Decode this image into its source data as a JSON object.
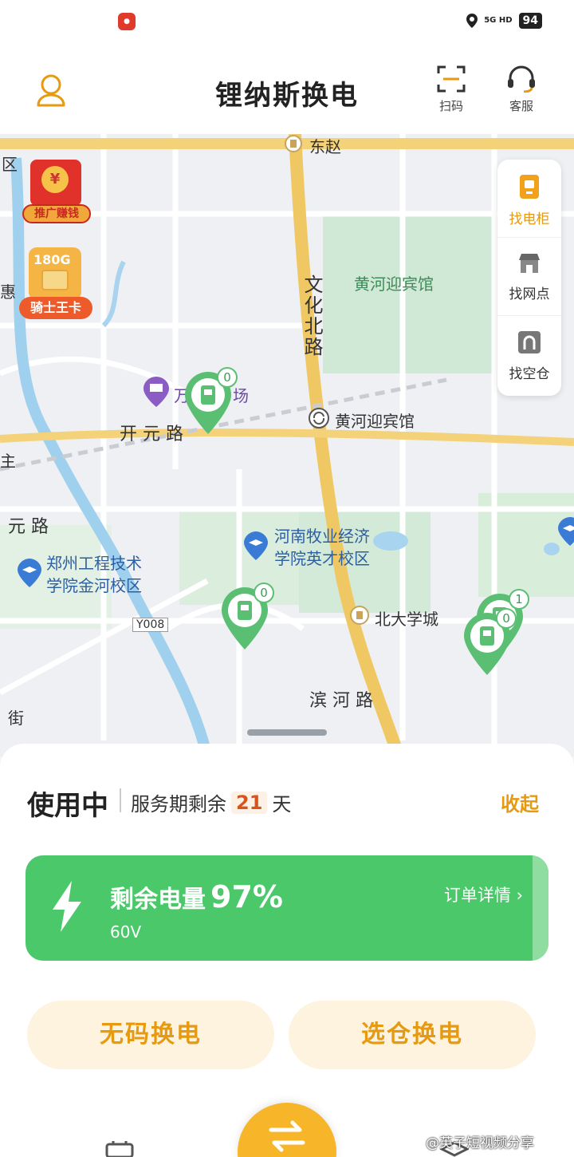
{
  "status_bar": {
    "network": "5G HD",
    "battery": "94"
  },
  "header": {
    "title": "锂纳斯换电",
    "scan_label": "扫码",
    "service_label": "客服"
  },
  "promos": {
    "earn_label": "推广赚钱",
    "sim_data": "180G",
    "sim_label": "骑士王卡"
  },
  "quick_panel": {
    "find_cabinet": "找电柜",
    "find_outlet": "找网点",
    "find_empty": "找空仓"
  },
  "map": {
    "labels": {
      "dongzhao": "东赵",
      "qu": "区",
      "hui": "惠",
      "wenhua_road": "文化北路",
      "yellow_river_hotel_area": "黄河迎宾馆",
      "wan_plaza": "万",
      "chang": "场",
      "kaiyuan_road": "开 元 路",
      "yellow_river_hotel_poi": "黄河迎宾馆",
      "zhu": "主",
      "kaiyuan_road_2": "元 路",
      "henan_college": "河南牧业经济\n学院英才校区",
      "zhengzhou_college": "郑州工程技术\n学院金河校区",
      "y008": "Y008",
      "beida_city": "北大学城",
      "binhe_road": "滨 河 路",
      "jie": "街"
    },
    "markers": [
      {
        "count": "0"
      },
      {
        "count": "0"
      },
      {
        "count": "1"
      },
      {
        "count": "0"
      }
    ]
  },
  "sheet": {
    "status": "使用中",
    "service_prefix": "服务期剩余",
    "days": "21",
    "days_unit": "天",
    "collapse": "收起",
    "battery_label": "剩余电量",
    "battery_percent": "97%",
    "voltage": "60V",
    "order_details": "订单详情 ›",
    "swap_no_code": "无码换电",
    "swap_select": "选仓换电"
  },
  "watermark": "@英子短视频分享",
  "colors": {
    "accent": "#E59A12",
    "battery_green": "#4AC86A",
    "marker_green": "#5BBF73",
    "fab": "#F7B52A"
  }
}
